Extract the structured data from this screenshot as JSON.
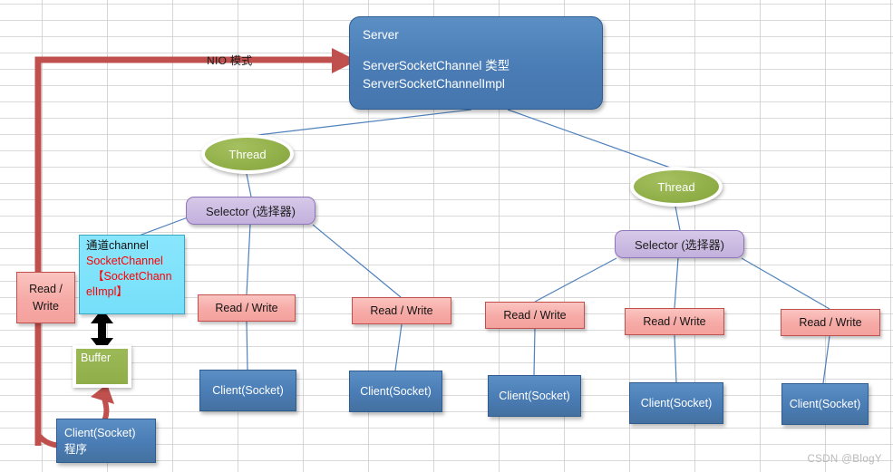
{
  "diagram": {
    "title_label": "NIO 模式",
    "watermark": "CSDN @BlogY",
    "server": {
      "line1": "Server",
      "line2": "ServerSocketChannel 类型",
      "line3": "ServerSocketChannelImpl"
    },
    "threads": [
      {
        "label": "Thread"
      },
      {
        "label": "Thread"
      }
    ],
    "selectors": [
      {
        "label": "Selector (选择器)"
      },
      {
        "label": "Selector (选择器)"
      }
    ],
    "read_write_boxes": [
      {
        "label": "Read / Write"
      },
      {
        "label": "Read / Write"
      },
      {
        "label": "Read / Write"
      },
      {
        "label": "Read / Write"
      },
      {
        "label": "Read / Write"
      },
      {
        "label": "Read / Write"
      }
    ],
    "clients": [
      {
        "label": "Client(Socket)"
      },
      {
        "label": "Client(Socket)"
      },
      {
        "label": "Client(Socket)"
      },
      {
        "label": "Client(Socket)"
      },
      {
        "label": "Client(Socket)"
      }
    ],
    "client_program": {
      "line1": "Client(Socket)",
      "line2": "程序"
    },
    "channel": {
      "line1_cn": "通道",
      "line1_en": "channel",
      "line2": "SocketChannel",
      "line3": "【SocketChann",
      "line4": "elImpl】"
    },
    "buffer": {
      "label": "Buffer"
    },
    "colors": {
      "server_blue": "#4a7cb5",
      "thread_green": "#8fae47",
      "selector_purple": "#c9b8e1",
      "read_write_pink": "#f6aaa6",
      "client_blue": "#4a7cb5",
      "channel_cyan": "#7fe3fb",
      "buffer_green": "#8fae49",
      "arrow_red": "#c0504d",
      "connector_blue": "#4f81bd",
      "grid_gray": "#d5d5d5",
      "highlight_red": "#ff0000"
    }
  }
}
